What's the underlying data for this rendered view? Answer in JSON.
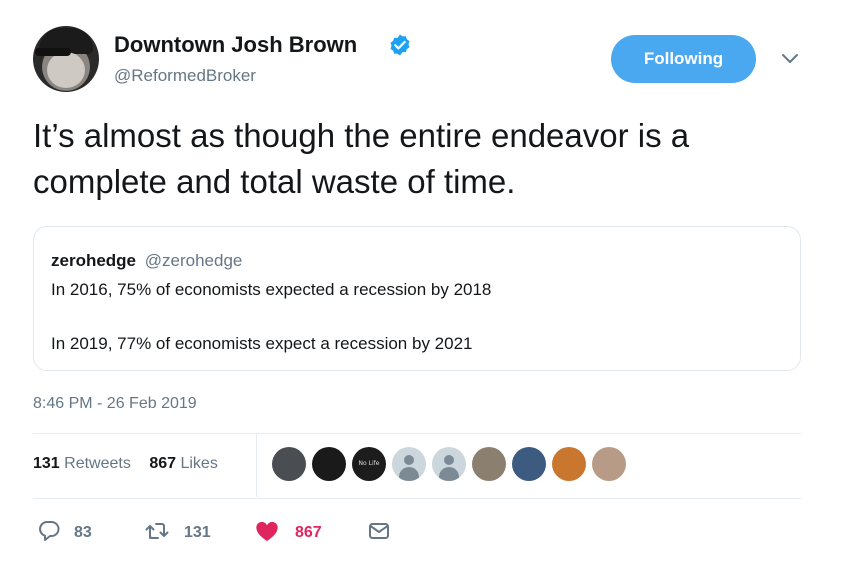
{
  "author": {
    "display_name": "Downtown Josh Brown",
    "handle": "@ReformedBroker",
    "verified": true
  },
  "follow_button": {
    "label": "Following"
  },
  "tweet": {
    "text_line_1": "It’s almost as though the entire endeavor is a",
    "text_line_2": "complete and total waste of time."
  },
  "quoted_tweet": {
    "display_name": "zerohedge",
    "handle": "@zerohedge",
    "line_1": "In 2016, 75% of economists expected a recession by 2018",
    "line_2": "In 2019, 77% of economists expect a recession by 2021"
  },
  "timestamp": "8:46 PM - 26 Feb 2019",
  "stats": {
    "retweets_count": "131",
    "retweets_label": "Retweets",
    "likes_count": "867",
    "likes_label": "Likes"
  },
  "liker_avatars": [
    {
      "kind": "photo",
      "color": "#4a4e52"
    },
    {
      "kind": "photo",
      "color": "#1a1a1a"
    },
    {
      "kind": "logo",
      "text": "No Life",
      "color": "#1c1c1c"
    },
    {
      "kind": "default"
    },
    {
      "kind": "default"
    },
    {
      "kind": "photo",
      "color": "#8b7f70"
    },
    {
      "kind": "photo",
      "color": "#3d5a80"
    },
    {
      "kind": "photo",
      "color": "#c9772f"
    },
    {
      "kind": "photo",
      "color": "#b79b86"
    }
  ],
  "actions": {
    "reply_count": "83",
    "retweet_count": "131",
    "like_count": "867"
  },
  "colors": {
    "accent": "#1da1f2",
    "follow_button": "#4aa8f0",
    "like": "#e0245e",
    "secondary_text": "#657786"
  },
  "icons": [
    "verified-badge-icon",
    "chevron-down-icon",
    "reply-icon",
    "retweet-icon",
    "heart-icon",
    "mail-icon"
  ]
}
